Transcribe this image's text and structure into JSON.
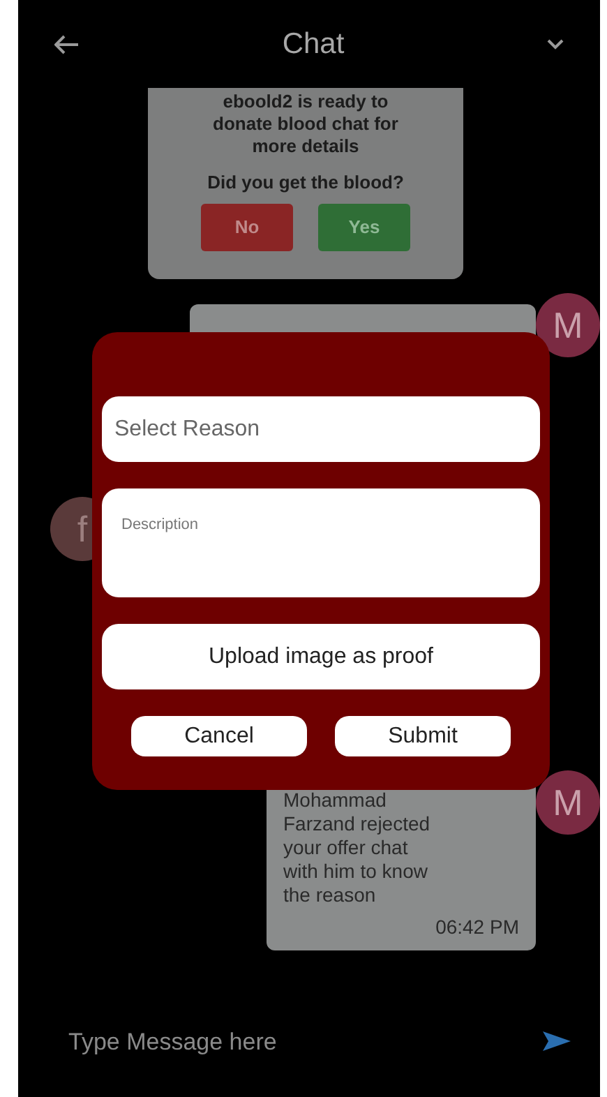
{
  "header": {
    "title": "Chat"
  },
  "request_card": {
    "message": "eboold2 is ready to donate blood chat for more details",
    "question": "Did you get the blood?",
    "buttons": [
      {
        "label": "No",
        "kind": "reject"
      },
      {
        "label": "Yes",
        "kind": "accept"
      }
    ]
  },
  "messages": [
    {
      "kind": "outgoing",
      "avatar": "M"
    },
    {
      "kind": "incoming",
      "avatar": "f"
    },
    {
      "kind": "outgoing",
      "avatar": "M",
      "text": "Mohammad Farzand rejected your offer chat with him to know the reason",
      "time": "06:42 PM"
    }
  ],
  "dialog": {
    "reason_field": {
      "placeholder": "Select Reason"
    },
    "description_field": {
      "placeholder": "Description"
    },
    "upload_button": "Upload image as proof",
    "buttons": [
      {
        "label": "Cancel"
      },
      {
        "label": "Submit"
      }
    ]
  },
  "composer": {
    "placeholder": "Type Message here"
  }
}
